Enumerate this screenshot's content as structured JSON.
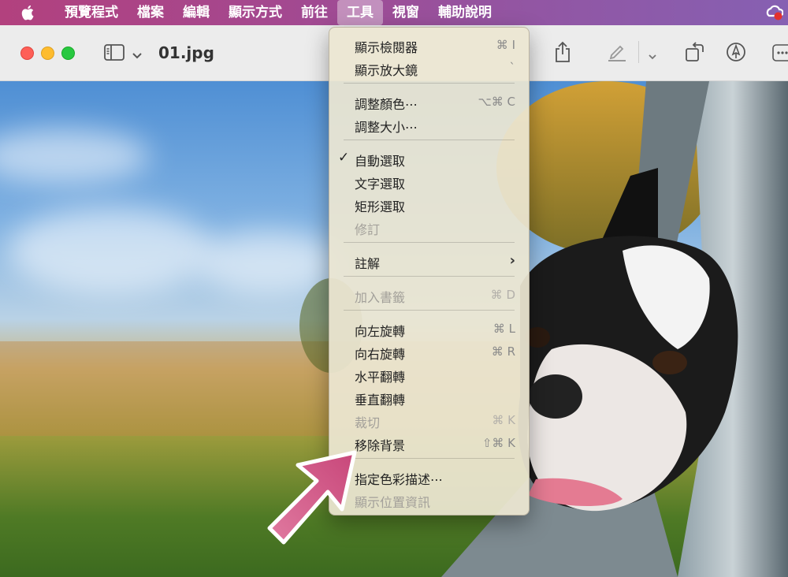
{
  "menubar": {
    "items": [
      "預覽程式",
      "檔案",
      "編輯",
      "顯示方式",
      "前往",
      "工具",
      "視窗",
      "輔助說明"
    ],
    "active_index": 5,
    "colors": {
      "start": "#b2417e",
      "end": "#8660b2"
    }
  },
  "window": {
    "title": "01.jpg"
  },
  "tools_menu": {
    "items": [
      {
        "label": "顯示檢閱器",
        "shortcut": "⌘ I"
      },
      {
        "label": "顯示放大鏡",
        "shortcut": "`"
      },
      {
        "label": "調整顏色⋯",
        "shortcut": "⌥⌘ C"
      },
      {
        "label": "調整大小⋯",
        "shortcut": ""
      },
      {
        "label": "自動選取",
        "shortcut": "",
        "checked": true
      },
      {
        "label": "文字選取",
        "shortcut": ""
      },
      {
        "label": "矩形選取",
        "shortcut": ""
      },
      {
        "label": "修訂",
        "shortcut": "",
        "disabled": true
      },
      {
        "label": "註解",
        "shortcut": "",
        "submenu": true
      },
      {
        "label": "加入書籤",
        "shortcut": "⌘ D",
        "disabled": true
      },
      {
        "label": "向左旋轉",
        "shortcut": "⌘ L"
      },
      {
        "label": "向右旋轉",
        "shortcut": "⌘ R"
      },
      {
        "label": "水平翻轉",
        "shortcut": ""
      },
      {
        "label": "垂直翻轉",
        "shortcut": ""
      },
      {
        "label": "裁切",
        "shortcut": "⌘ K",
        "disabled": true
      },
      {
        "label": "移除背景",
        "shortcut": "⇧⌘ K"
      },
      {
        "label": "指定色彩描述⋯",
        "shortcut": ""
      },
      {
        "label": "顯示位置資訊",
        "shortcut": "",
        "disabled": true
      }
    ]
  },
  "annotation": {
    "arrow_color": "#c8477a"
  }
}
